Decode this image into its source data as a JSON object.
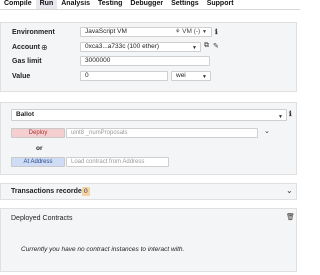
{
  "tabs": [
    "Compile",
    "Run",
    "Analysis",
    "Testing",
    "Debugger",
    "Settings",
    "Support"
  ],
  "active_tab": "Run",
  "env": {
    "environment_label": "Environment",
    "environment_value": "JavaScript VM",
    "vm_badge": "VM (-)",
    "account_label": "Account",
    "account_value": "0xca3...a733c (100 ether)",
    "gas_label": "Gas limit",
    "gas_value": "3000000",
    "value_label": "Value",
    "value_value": "0",
    "unit_value": "wei"
  },
  "contract": {
    "selected": "Ballot",
    "deploy_label": "Deploy",
    "deploy_placeholder": "uint8 _numProposals",
    "or_label": "or",
    "at_address_label": "At Address",
    "at_address_placeholder": "Load contract from Address"
  },
  "transactions": {
    "label": "Transactions recorded:",
    "count": "0"
  },
  "deployed": {
    "label": "Deployed Contracts",
    "empty_message": "Currently you have no contract instances to interact with."
  },
  "colors": {
    "deploy_bg": "#f5cfcf",
    "at_address_bg": "#cfdcf5",
    "badge_bg": "#f4d4a4",
    "panel_bg": "#f4f5f7"
  }
}
